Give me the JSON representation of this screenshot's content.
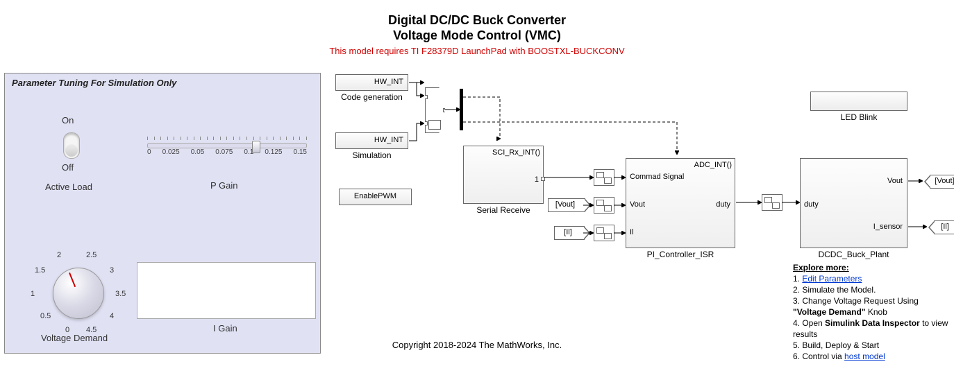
{
  "title_line1": "Digital DC/DC Buck Converter",
  "title_line2": "Voltage Mode Control (VMC)",
  "warning": "This model requires TI F28379D LaunchPad with BOOSTXL-BUCKCONV",
  "copyright": "Copyright 2018-2024 The MathWorks, Inc.",
  "panel": {
    "title": "Parameter Tuning For Simulation Only",
    "switch_on": "On",
    "switch_off": "Off",
    "active_load": "Active Load",
    "p_gain": "P Gain",
    "i_gain": "I Gain",
    "voltage_demand": "Voltage Demand",
    "slider_ticks": [
      "0",
      "0.025",
      "0.05",
      "0.075",
      "0.1",
      "0.125",
      "0.15"
    ],
    "knob_ticks": [
      "0",
      "0.5",
      "1",
      "1.5",
      "2",
      "2.5",
      "3",
      "3.5",
      "4",
      "4.5"
    ]
  },
  "blocks": {
    "hw_int_top": "HW_INT",
    "hw_int_bot": "HW_INT",
    "code_gen": "Code generation",
    "simulation": "Simulation",
    "enable_pwm": "EnablePWM",
    "serial_rx_fn": "SCI_Rx_INT()",
    "serial_rx_name": "Serial Receive",
    "adc_fn": "ADC_INT()",
    "command_signal": "Commad Signal",
    "vout": "Vout",
    "il": "Il",
    "duty": "duty",
    "pi_name": "PI_Controller_ISR",
    "led_blink": "LED Blink",
    "plant_vout": "Vout",
    "plant_isensor": "I_sensor",
    "plant_duty": "duty",
    "plant_name": "DCDC_Buck_Plant",
    "tag_vout": "[Vout]",
    "tag_il": "[Il]",
    "tag_vout_out": "[Vout]",
    "tag_il_out": "[Il]",
    "port_1": "1"
  },
  "explore": {
    "heading": "Explore more:",
    "l1a": "1. ",
    "l1b": "Edit Parameters",
    "l2": "2. Simulate the Model.",
    "l3a": "3. Change Voltage Request Using",
    "l3b": "\"Voltage Demand\"",
    "l3c": " Knob",
    "l4a": "4. Open ",
    "l4b": "Simulink Data Inspector",
    "l4c": " to view results",
    "l5": "5. Build, Deploy & Start",
    "l6a": "6. Control via ",
    "l6b": "host model"
  }
}
